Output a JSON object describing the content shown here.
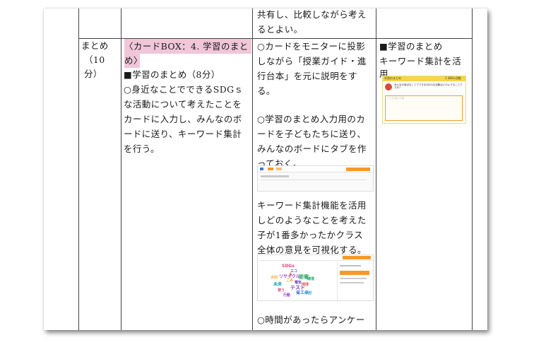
{
  "cells": {
    "col3_top_line1": "共有し、比較しながら考え",
    "col3_top_line2": "るとよい。",
    "col1_line1": "まとめ",
    "col1_line2": "（10",
    "col1_line3": "分）",
    "col2_highlight_line1": "〈カードBOX：4. 学習のまと",
    "col2_highlight_line2": "め〉",
    "col2_line3": "■学習のまとめ（8分）",
    "col2_line4": "○身近なことでできるSDGｓ",
    "col2_line5": "な活動について考えたことを",
    "col2_line6": "カードに入力し、みんなのボ",
    "col2_line7": "ードに送り、キーワード集計",
    "col2_line8": "を行う。",
    "col3_line1": "○カードをモニターに投影",
    "col3_line2": "しながら「授業ガイド・進",
    "col3_line3": "行台本」を元に説明をす",
    "col3_line4": "る。",
    "col3_line5": "○学習のまとめ入力用のカ",
    "col3_line6": "ードを子どもたちに送り、",
    "col3_line7": "みんなのボードにタブを作",
    "col3_line8": "っておく。",
    "col3_line9": "キーワード集計機能を活用",
    "col3_line10": "しどのようなことを考えた",
    "col3_line11": "子が1番多かったかクラス",
    "col3_line12": "全体の意見を可視化する。",
    "col3_line13": "○時間があったらアンケー",
    "col4_line1": "■学習のまとめ",
    "col4_line2": "キーワード集計を活",
    "col4_line3": "用"
  },
  "card_thumb": {
    "title": "学習のまとめ",
    "badge": "1 SDGs活動",
    "prompt": "みんなの身近なことでできるSDGsな活動はどのようなことですか？",
    "placeholder": "ここにかいてね"
  },
  "word_cloud": [
    "SDGs",
    "エコ",
    "リサイクル",
    "節電",
    "ごみ",
    "未来",
    "地球",
    "テスト",
    "使う",
    "省エネ",
    "行動",
    "環境",
    "大切",
    "分別",
    "水",
    "電気"
  ],
  "colors": {
    "highlight": "#f0c6d8",
    "accent_orange": "#f39a2b",
    "card_yellow": "#f6d64a"
  }
}
